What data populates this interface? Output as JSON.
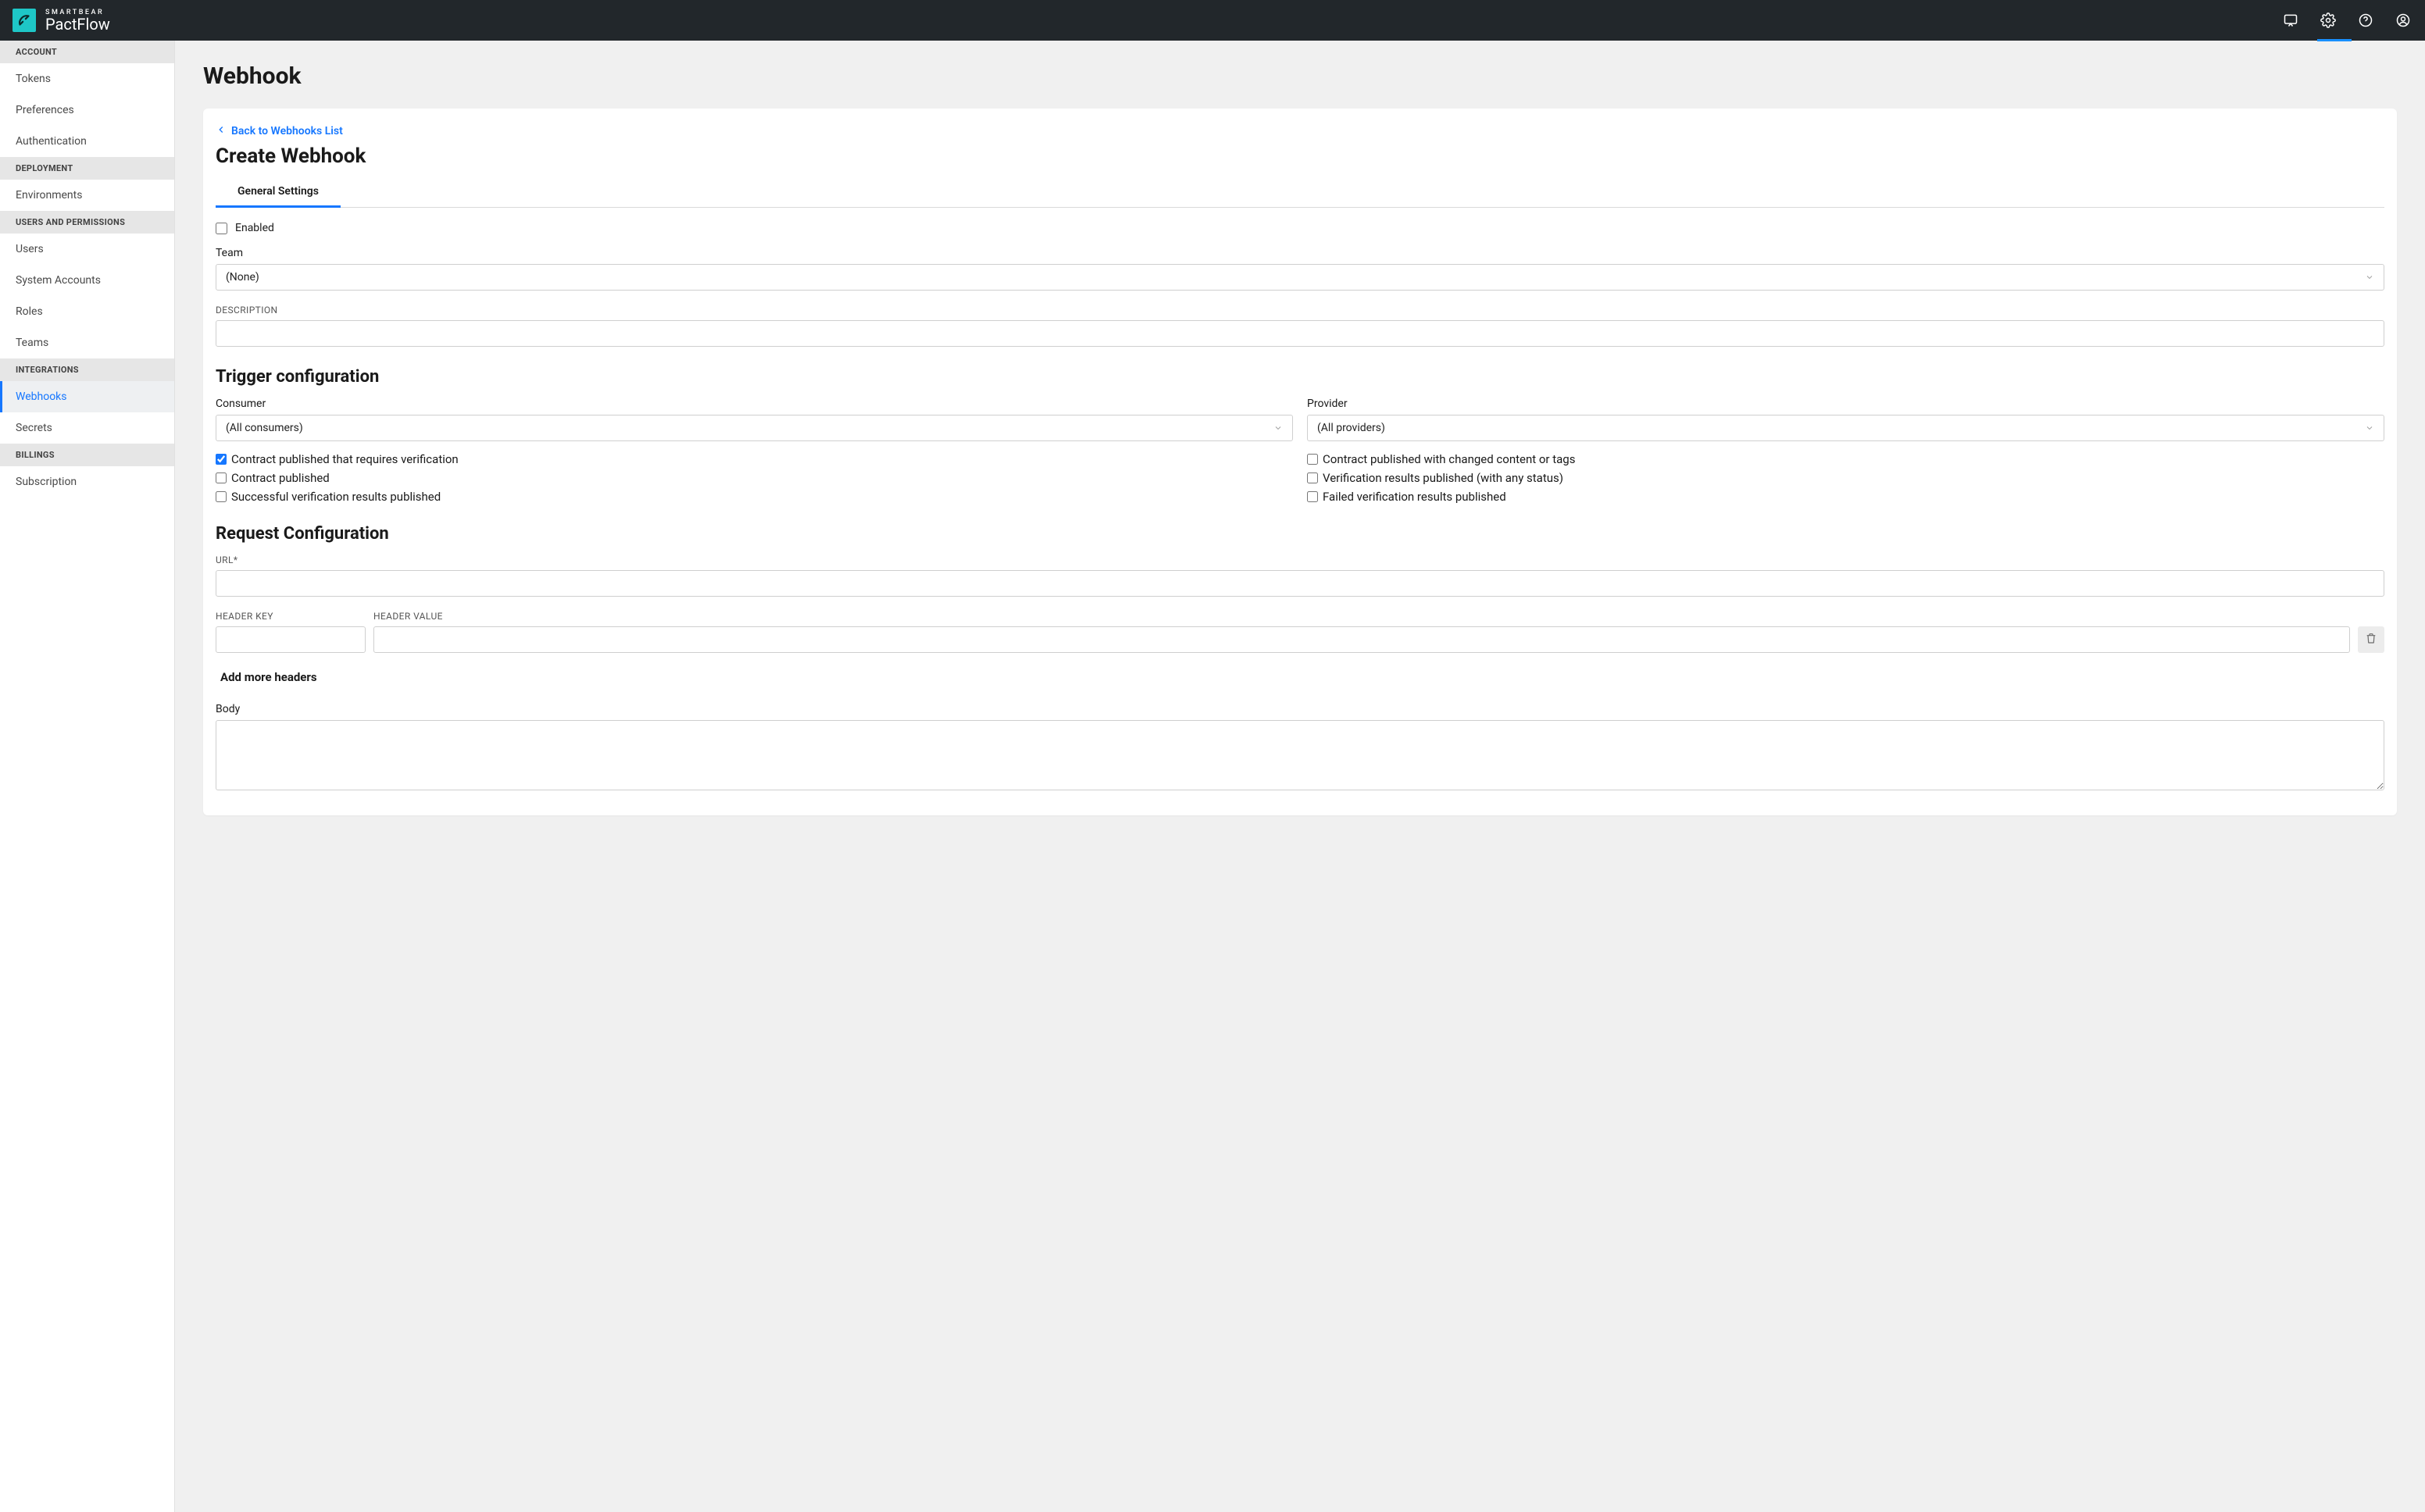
{
  "brand": {
    "top": "SMARTBEAR",
    "main": "PactFlow"
  },
  "sidebar": {
    "sections": [
      {
        "header": "ACCOUNT",
        "items": [
          "Tokens",
          "Preferences",
          "Authentication"
        ]
      },
      {
        "header": "DEPLOYMENT",
        "items": [
          "Environments"
        ]
      },
      {
        "header": "USERS AND PERMISSIONS",
        "items": [
          "Users",
          "System Accounts",
          "Roles",
          "Teams"
        ]
      },
      {
        "header": "INTEGRATIONS",
        "items": [
          "Webhooks",
          "Secrets"
        ]
      },
      {
        "header": "BILLINGS",
        "items": [
          "Subscription"
        ]
      }
    ],
    "active": "Webhooks"
  },
  "page": {
    "title": "Webhook",
    "back": "Back to Webhooks List",
    "card_title": "Create Webhook",
    "tab": "General Settings",
    "enabled_label": "Enabled",
    "team_label": "Team",
    "team_value": "(None)",
    "description_label": "DESCRIPTION",
    "trigger_h": "Trigger configuration",
    "consumer_label": "Consumer",
    "consumer_value": "(All consumers)",
    "provider_label": "Provider",
    "provider_value": "(All providers)",
    "events": {
      "left": [
        {
          "label": "Contract published that requires verification",
          "checked": true
        },
        {
          "label": "Contract published",
          "checked": false
        },
        {
          "label": "Successful verification results published",
          "checked": false
        }
      ],
      "right": [
        {
          "label": "Contract published with changed content or tags",
          "checked": false
        },
        {
          "label": "Verification results published (with any status)",
          "checked": false
        },
        {
          "label": "Failed verification results published",
          "checked": false
        }
      ]
    },
    "request_h": "Request Configuration",
    "url_label": "URL*",
    "header_key_label": "HEADER KEY",
    "header_value_label": "HEADER VALUE",
    "add_more": "Add more headers",
    "body_label": "Body"
  }
}
